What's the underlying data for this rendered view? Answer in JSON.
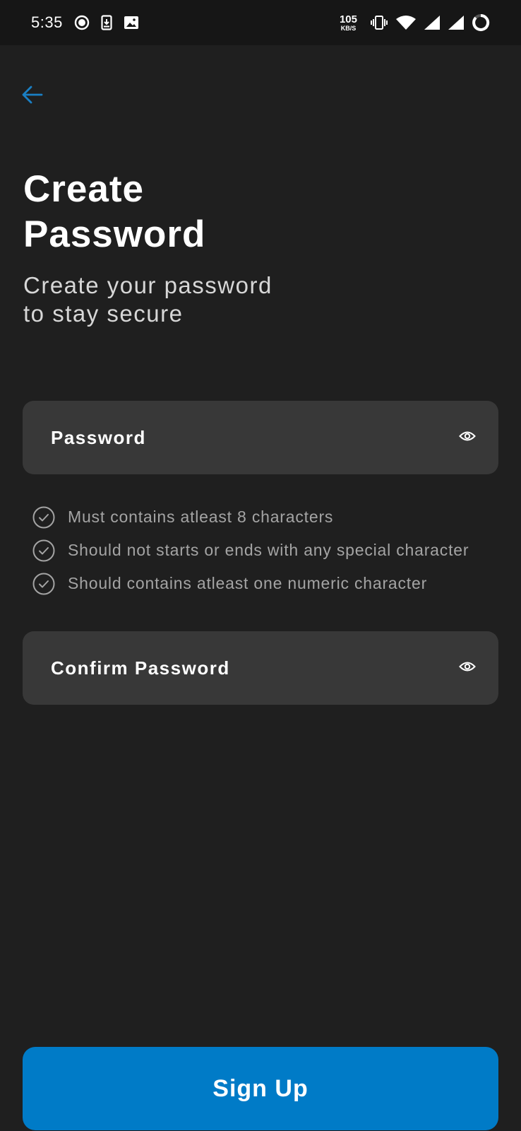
{
  "status_bar": {
    "time": "5:35",
    "net_speed_value": "105",
    "net_speed_unit": "KB/S",
    "left_icons": [
      "record-icon",
      "download-icon",
      "image-icon"
    ],
    "right_icons": [
      "vibrate-icon",
      "wifi-icon",
      "signal-icon",
      "signal-icon",
      "battery-icon"
    ]
  },
  "header": {
    "back_icon": "arrow-left-icon",
    "title_line1": "Create",
    "title_line2": "Password",
    "subtitle_line1": "Create your password",
    "subtitle_line2": "to stay secure"
  },
  "form": {
    "password_label": "Password",
    "confirm_label": "Confirm Password",
    "toggle_icon": "eye-icon",
    "rules": [
      "Must contains atleast 8 characters",
      "Should not starts or ends with any special character",
      "Should contains atleast one numeric character"
    ],
    "rule_icon": "check-circle-icon"
  },
  "actions": {
    "signup_label": "Sign Up"
  },
  "colors": {
    "background": "#1f1f1f",
    "status_bar": "#161616",
    "field": "#383838",
    "accent": "#007bc7",
    "back_arrow": "#1a7fc4",
    "rule_text": "#a4a4a4"
  }
}
